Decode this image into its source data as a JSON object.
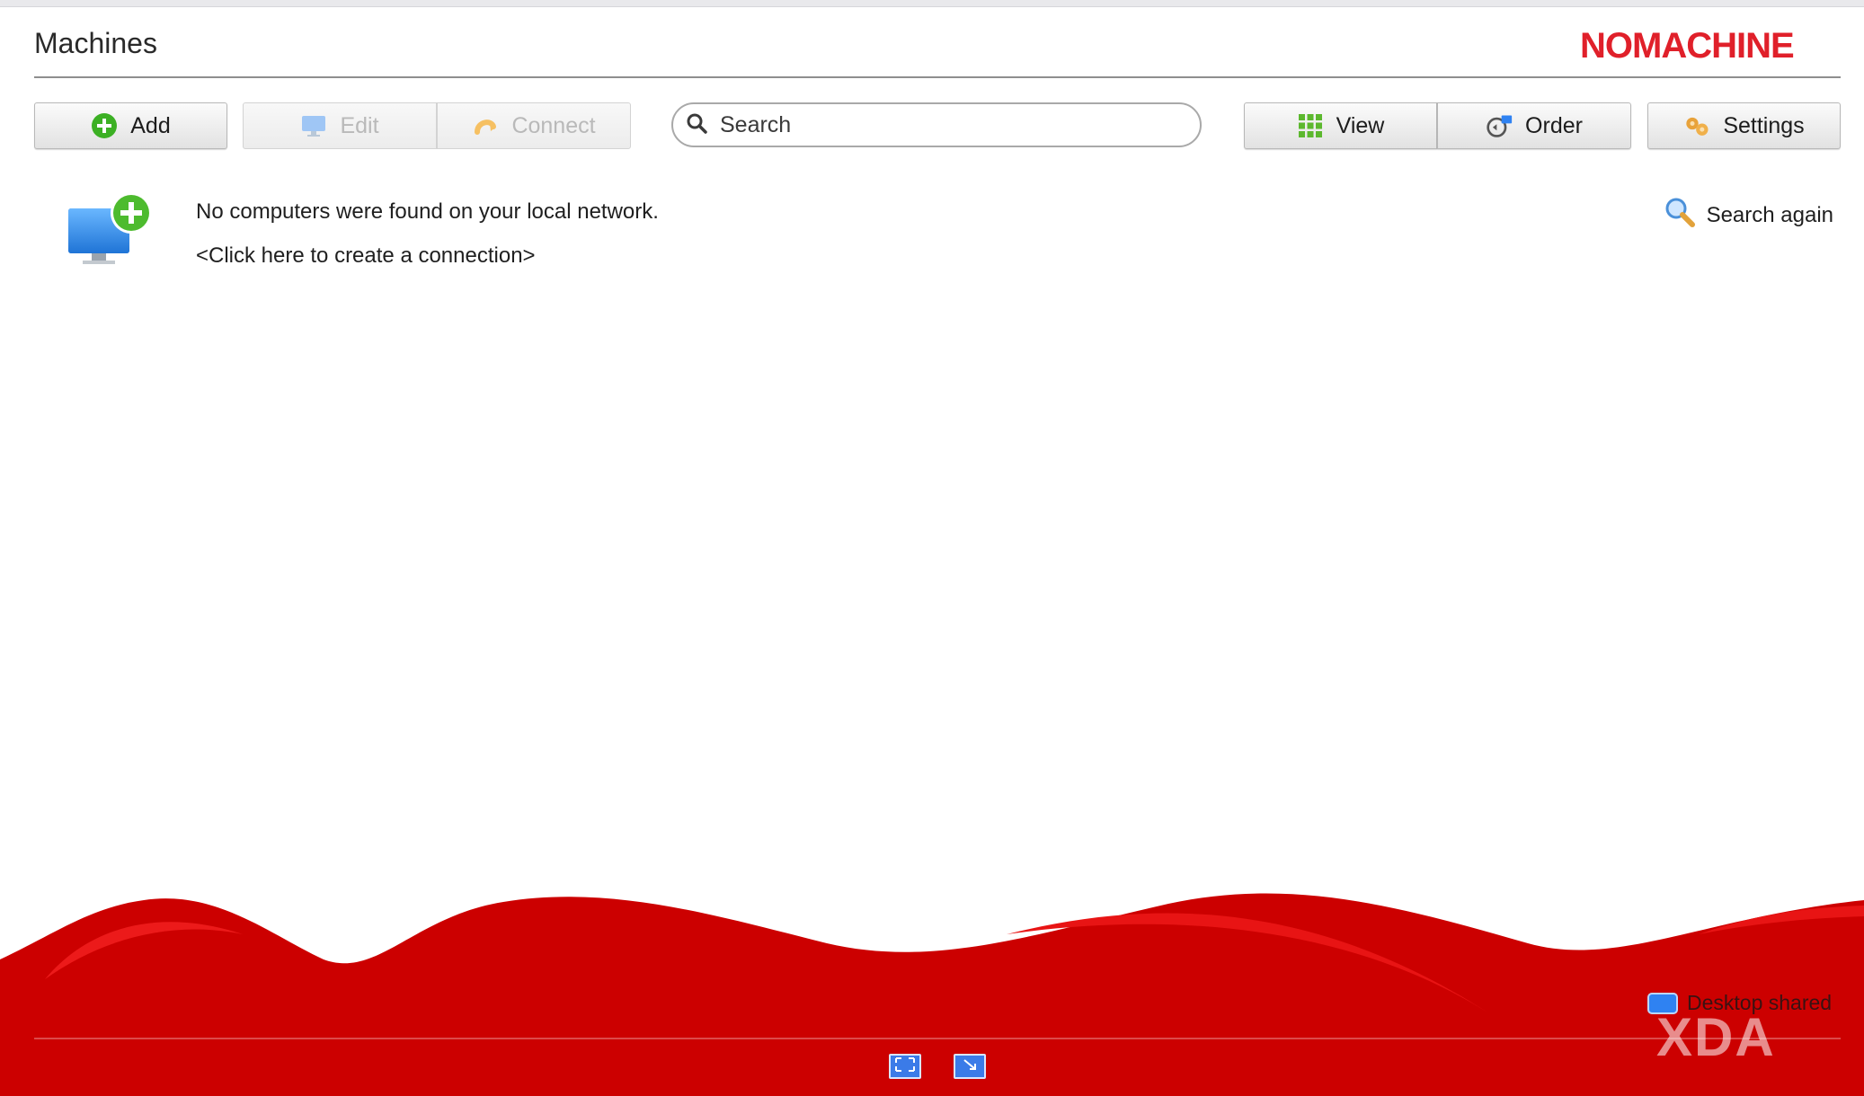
{
  "header": {
    "title": "Machines",
    "logo_text": "NOMACHINE",
    "logo_color": "#e0202a"
  },
  "toolbar": {
    "add_label": "Add",
    "edit_label": "Edit",
    "connect_label": "Connect",
    "search_placeholder": "Search",
    "view_label": "View",
    "order_label": "Order",
    "settings_label": "Settings"
  },
  "main": {
    "empty_message": "No computers were found on your local network.",
    "create_link": "<Click here to create a connection>",
    "search_again_label": "Search again"
  },
  "footer": {
    "desktop_shared_label": "Desktop shared",
    "watermark_text": "XDA",
    "brand_red": "#cc0000"
  }
}
